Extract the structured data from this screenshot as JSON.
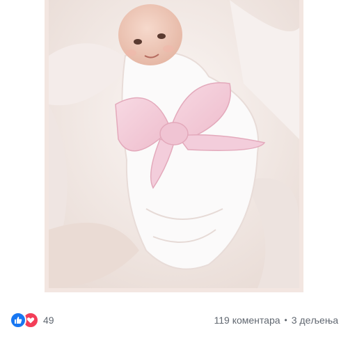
{
  "post": {
    "photo_description_icon": "baby-photo"
  },
  "reactions": {
    "types": [
      "like-icon",
      "love-icon"
    ],
    "count": "49"
  },
  "engagement": {
    "comments": "119 коментара",
    "separator": "•",
    "shares": "3 дељења"
  },
  "colors": {
    "like": "#1877f2",
    "love": "#f33e58",
    "meta_text": "#606770"
  }
}
